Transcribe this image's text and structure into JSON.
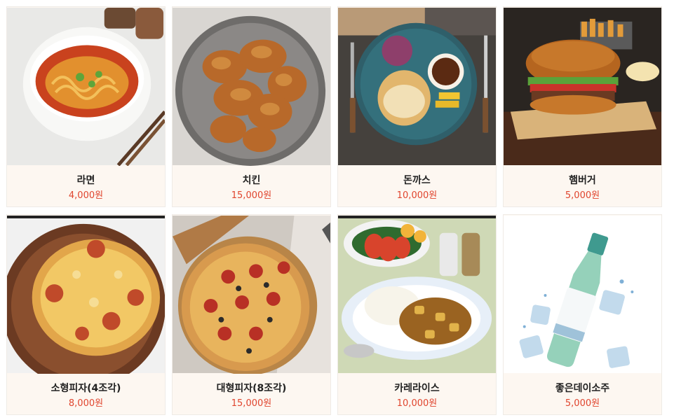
{
  "menu": {
    "items": [
      {
        "name": "라면",
        "price": "4,000원",
        "image_icon": "ramen-photo"
      },
      {
        "name": "치킨",
        "price": "15,000원",
        "image_icon": "fried-chicken-photo"
      },
      {
        "name": "돈까스",
        "price": "10,000원",
        "image_icon": "pork-cutlet-photo"
      },
      {
        "name": "햄버거",
        "price": "5,000원",
        "image_icon": "hamburger-photo"
      },
      {
        "name": "소형피자(4조각)",
        "price": "8,000원",
        "image_icon": "small-pizza-photo"
      },
      {
        "name": "대형피자(8조각)",
        "price": "15,000원",
        "image_icon": "large-pizza-photo"
      },
      {
        "name": "카레라이스",
        "price": "10,000원",
        "image_icon": "curry-rice-photo"
      },
      {
        "name": "좋은데이소주",
        "price": "5,000원",
        "image_icon": "soju-bottle-photo"
      }
    ]
  },
  "colors": {
    "card_bg": "#fdf7f1",
    "price": "#e0452e",
    "name": "#222222"
  }
}
